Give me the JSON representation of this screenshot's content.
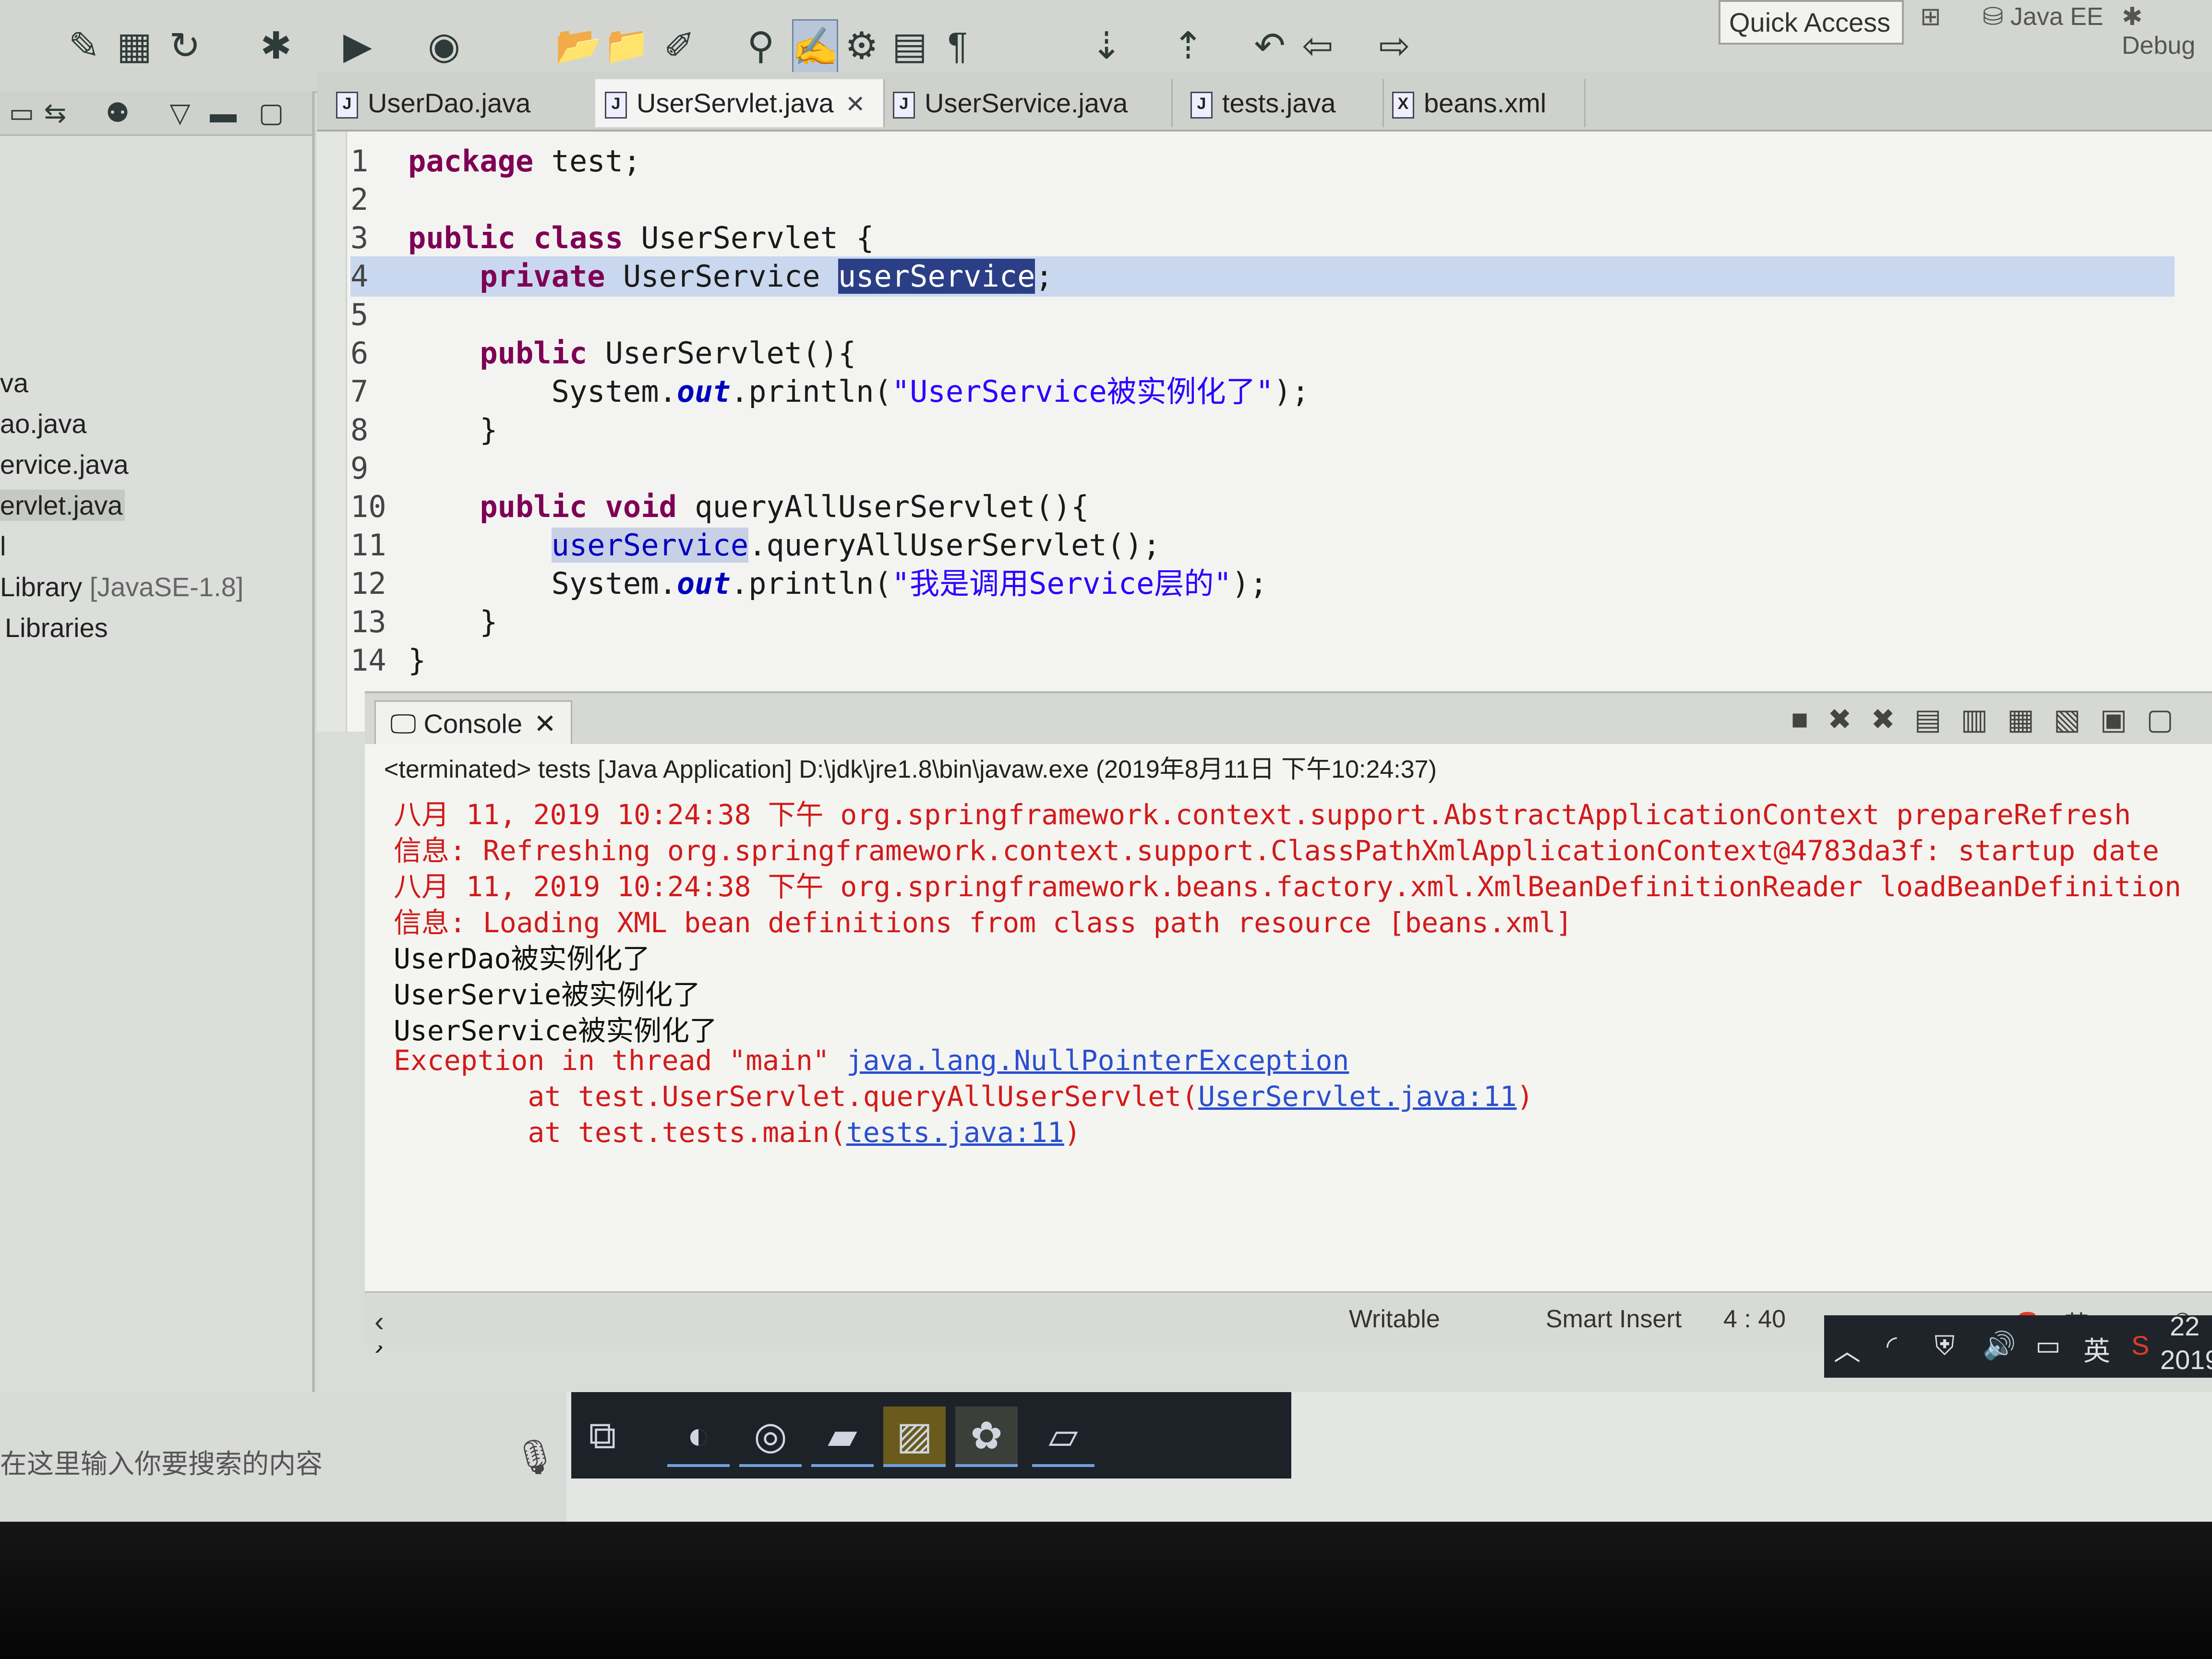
{
  "toolbar": {
    "quick_access": "Quick Access",
    "perspective_javaee": "Java EE",
    "perspective_debug": "Debug",
    "icons": [
      "skip-breakpoints-icon",
      "new-server-icon",
      "refresh-icon",
      "debug-icon",
      "run-icon",
      "external-tools-icon",
      "open-folder-icon",
      "open-type-icon",
      "brush-icon",
      "pin-icon",
      "highlight-icon",
      "annotation-icon",
      "block-icon",
      "pilcrow-icon",
      "next-annotation-icon",
      "prev-annotation-icon",
      "back-icon",
      "forward-icon"
    ]
  },
  "explorer": {
    "items": [
      {
        "label": "va"
      },
      {
        "label": "ao.java"
      },
      {
        "label": "ervice.java"
      },
      {
        "label": "ervlet.java"
      },
      {
        "label": "l"
      },
      {
        "label": "Library",
        "suffix": " [JavaSE-1.8]"
      },
      {
        "label": "Libraries"
      }
    ]
  },
  "tabs": [
    {
      "label": "UserDao.java"
    },
    {
      "label": "UserServlet.java"
    },
    {
      "label": "UserService.java"
    },
    {
      "label": "tests.java"
    },
    {
      "label": "beans.xml"
    }
  ],
  "editor": {
    "lines": [
      {
        "n": "1",
        "text": "package test;"
      },
      {
        "n": "2",
        "text": ""
      },
      {
        "n": "3",
        "text": "public class UserServlet {"
      },
      {
        "n": "4",
        "text": "    private UserService userService;"
      },
      {
        "n": "5",
        "text": ""
      },
      {
        "n": "6",
        "text": "    public UserServlet(){"
      },
      {
        "n": "7",
        "text": "        System.out.println(\"UserService被实例化了\");"
      },
      {
        "n": "8",
        "text": "    }"
      },
      {
        "n": "9",
        "text": ""
      },
      {
        "n": "10",
        "text": "    public void queryAllUserServlet(){"
      },
      {
        "n": "11",
        "text": "        userService.queryAllUserServlet();"
      },
      {
        "n": "12",
        "text": "        System.out.println(\"我是调用Service层的\");"
      },
      {
        "n": "13",
        "text": "    }"
      },
      {
        "n": "14",
        "text": "}"
      }
    ]
  },
  "console": {
    "tab_label": "Console",
    "terminated": "<terminated> tests [Java Application] D:\\jdk\\jre1.8\\bin\\javaw.exe (2019年8月11日 下午10:24:37)",
    "lines": [
      {
        "type": "err",
        "text": "八月 11, 2019 10:24:38 下午 org.springframework.context.support.AbstractApplicationContext prepareRefresh"
      },
      {
        "type": "err",
        "text": "信息: Refreshing org.springframework.context.support.ClassPathXmlApplicationContext@4783da3f: startup date"
      },
      {
        "type": "err",
        "text": "八月 11, 2019 10:24:38 下午 org.springframework.beans.factory.xml.XmlBeanDefinitionReader loadBeanDefinition"
      },
      {
        "type": "err",
        "text": "信息: Loading XML bean definitions from class path resource [beans.xml]"
      },
      {
        "type": "out",
        "text": "UserDao被实例化了"
      },
      {
        "type": "out",
        "text": "UserServie被实例化了"
      },
      {
        "type": "out",
        "text": "UserService被实例化了"
      }
    ],
    "exception_prefix": "Exception in thread \"main\" ",
    "exception_link": "java.lang.NullPointerException",
    "trace1_prefix": "        at test.UserServlet.queryAllUserServlet(",
    "trace1_link": "UserServlet.java:11",
    "trace1_suffix": ")",
    "trace2_prefix": "        at test.tests.main(",
    "trace2_link": "tests.java:11",
    "trace2_suffix": ")"
  },
  "status": {
    "writable": "Writable",
    "insert_mode": "Smart Insert",
    "position": "4 : 40"
  },
  "taskbar": {
    "search_placeholder": "在这里输入你要搜索的内容",
    "ime": "英",
    "time_partial": "22",
    "date_partial": "2019"
  }
}
